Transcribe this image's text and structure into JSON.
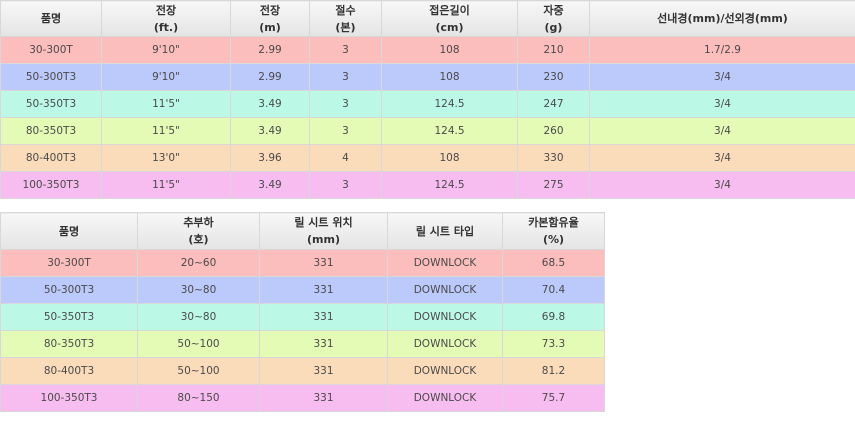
{
  "colors": {
    "row_30_300T": "#fcbdbd",
    "row_50_300T3": "#bcc9fb",
    "row_50_350T3": "#bbf9e6",
    "row_80_350T3": "#e4fbb6",
    "row_80_400T3": "#fbdcba",
    "row_100_350T3": "#f8bdf0",
    "header_bg": "#ebebeb"
  },
  "spec_table": {
    "headers": [
      {
        "line1": "품명",
        "line2": ""
      },
      {
        "line1": "전장",
        "line2": "(ft.)"
      },
      {
        "line1": "전장",
        "line2": "(m)"
      },
      {
        "line1": "절수",
        "line2": "(본)"
      },
      {
        "line1": "접은길이",
        "line2": "(cm)"
      },
      {
        "line1": "자중",
        "line2": "(g)"
      },
      {
        "line1": "선내경(mm)/선외경(mm)",
        "line2": ""
      }
    ],
    "rows": [
      [
        "30-300T",
        "9'10\"",
        "2.99",
        "3",
        "108",
        "210",
        "1.7/2.9"
      ],
      [
        "50-300T3",
        "9'10\"",
        "2.99",
        "3",
        "108",
        "230",
        "3/4"
      ],
      [
        "50-350T3",
        "11'5\"",
        "3.49",
        "3",
        "124.5",
        "247",
        "3/4"
      ],
      [
        "80-350T3",
        "11'5\"",
        "3.49",
        "3",
        "124.5",
        "260",
        "3/4"
      ],
      [
        "80-400T3",
        "13'0\"",
        "3.96",
        "4",
        "108",
        "330",
        "3/4"
      ],
      [
        "100-350T3",
        "11'5\"",
        "3.49",
        "3",
        "124.5",
        "275",
        "3/4"
      ]
    ]
  },
  "reel_table": {
    "headers": [
      {
        "line1": "품명",
        "line2": ""
      },
      {
        "line1": "추부하",
        "line2": "(호)"
      },
      {
        "line1": "릴 시트 위치",
        "line2": "(mm)"
      },
      {
        "line1": "릴 시트 타입",
        "line2": ""
      },
      {
        "line1": "카본함유율",
        "line2": "(%)"
      }
    ],
    "rows": [
      [
        "30-300T",
        "20~60",
        "331",
        "DOWNLOCK",
        "68.5"
      ],
      [
        "50-300T3",
        "30~80",
        "331",
        "DOWNLOCK",
        "70.4"
      ],
      [
        "50-350T3",
        "30~80",
        "331",
        "DOWNLOCK",
        "69.8"
      ],
      [
        "80-350T3",
        "50~100",
        "331",
        "DOWNLOCK",
        "73.3"
      ],
      [
        "80-400T3",
        "50~100",
        "331",
        "DOWNLOCK",
        "81.2"
      ],
      [
        "100-350T3",
        "80~150",
        "331",
        "DOWNLOCK",
        "75.7"
      ]
    ]
  }
}
